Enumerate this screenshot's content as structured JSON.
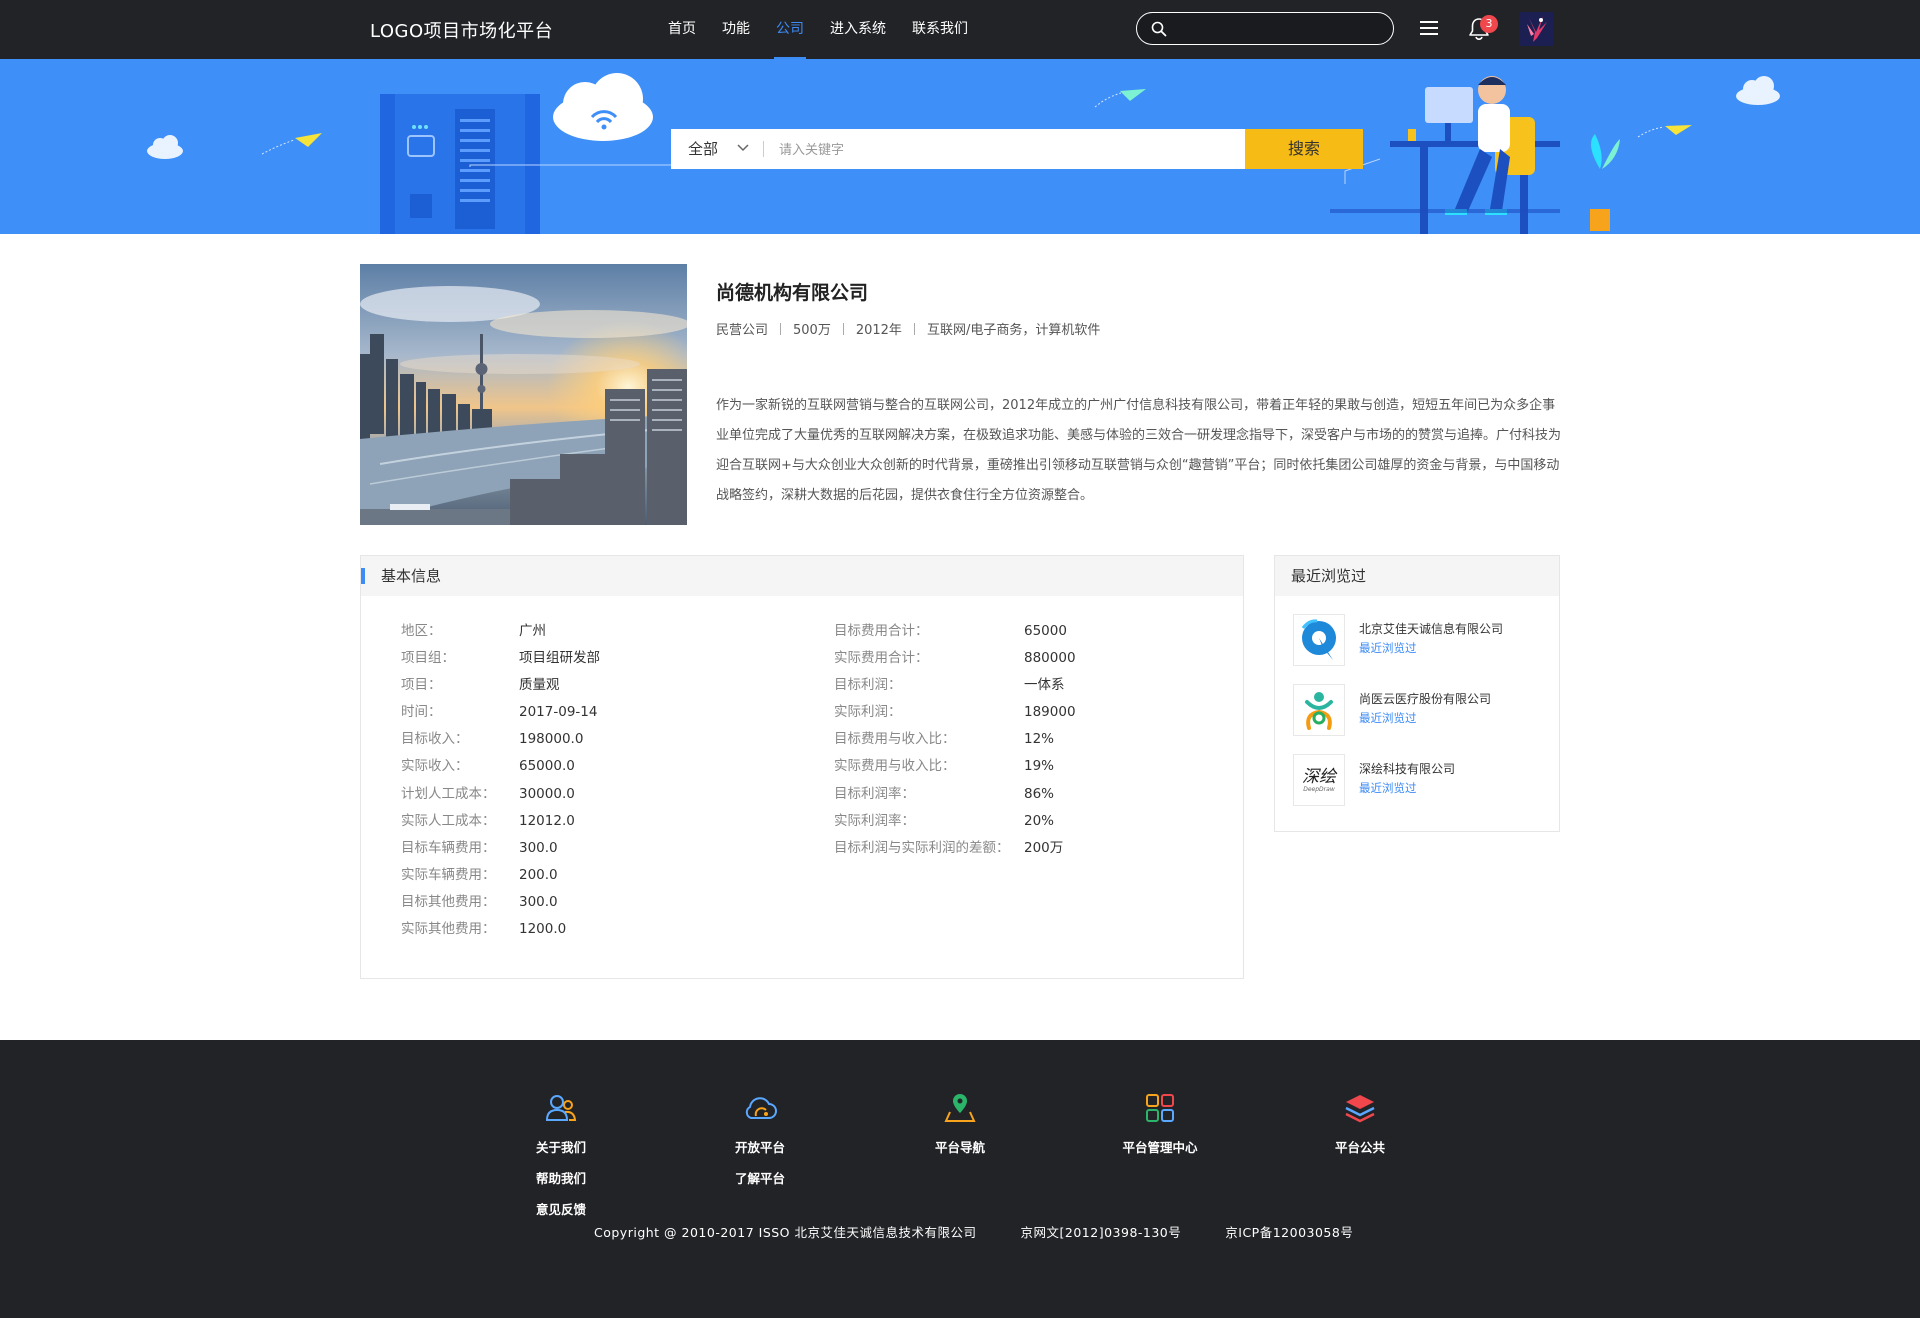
{
  "header": {
    "logo": "LOGO项目市场化平台",
    "nav": [
      "首页",
      "功能",
      "公司",
      "进入系统",
      "联系我们"
    ],
    "active_nav": "公司",
    "search_value": "",
    "notification_count": "3"
  },
  "banner": {
    "category": "全部",
    "search_placeholder": "请入关键字",
    "search_button": "搜索"
  },
  "company": {
    "name": "尚德机构有限公司",
    "meta": [
      "民营公司",
      "500万",
      "2012年",
      "互联网/电子商务，计算机软件"
    ],
    "description": "作为一家新锐的互联网营销与整合的互联网公司，2012年成立的广州广付信息科技有限公司，带着正年轻的果敢与创造，短短五年间已为众多企事业单位完成了大量优秀的互联网解决方案，在极致追求功能、美感与体验的三效合一研发理念指导下，深受客户与市场的的赞赏与追捧。广付科技为迎合互联网+与大众创业大众创新的时代背景，重磅推出引领移动互联营销与众创“趣营销”平台；同时依托集团公司雄厚的资金与背景，与中国移动战略签约，深耕大数据的后花园，提供衣食住行全方位资源整合。"
  },
  "basic_info": {
    "title": "基本信息",
    "left": [
      {
        "k": "地区：",
        "v": "广州"
      },
      {
        "k": "项目组：",
        "v": "项目组研发部"
      },
      {
        "k": "项目：",
        "v": "质量观"
      },
      {
        "k": "时间：",
        "v": "2017-09-14"
      },
      {
        "k": "目标收入：",
        "v": "198000.0"
      },
      {
        "k": "实际收入：",
        "v": "65000.0"
      },
      {
        "k": "计划人工成本：",
        "v": "30000.0"
      },
      {
        "k": "实际人工成本：",
        "v": "12012.0"
      },
      {
        "k": "目标车辆费用：",
        "v": "300.0"
      },
      {
        "k": "实际车辆费用：",
        "v": "200.0"
      },
      {
        "k": "目标其他费用：",
        "v": "300.0"
      },
      {
        "k": "实际其他费用：",
        "v": "1200.0"
      }
    ],
    "right": [
      {
        "k": "目标费用合计：",
        "v": "65000"
      },
      {
        "k": "实际费用合计：",
        "v": "880000"
      },
      {
        "k": "目标利润：",
        "v": "一体系"
      },
      {
        "k": "实际利润：",
        "v": "189000"
      },
      {
        "k": "目标费用与收入比：",
        "v": "12%"
      },
      {
        "k": "实际费用与收入比：",
        "v": "19%"
      },
      {
        "k": "目标利润率：",
        "v": "86%"
      },
      {
        "k": "实际利润率：",
        "v": "20%"
      },
      {
        "k": "目标利润与实际利润的差额：",
        "v": "200万"
      }
    ]
  },
  "recent": {
    "title": "最近浏览过",
    "items": [
      {
        "name": "北京艾佳天诚信息有限公司",
        "link": "最近浏览过"
      },
      {
        "name": "尚医云医疗股份有限公司",
        "link": "最近浏览过"
      },
      {
        "name": "深绘科技有限公司",
        "link": "最近浏览过"
      }
    ],
    "logo3_text": "深绘",
    "logo3_sub": "DeepDraw"
  },
  "footer": {
    "columns": [
      {
        "icon": "users-icon",
        "links": [
          "关于我们",
          "帮助我们",
          "意见反馈"
        ]
      },
      {
        "icon": "cloud-icon",
        "links": [
          "开放平台",
          "了解平台"
        ]
      },
      {
        "icon": "map-pin-icon",
        "links": [
          "平台导航"
        ]
      },
      {
        "icon": "grid-icon",
        "links": [
          "平台管理中心"
        ]
      },
      {
        "icon": "layers-icon",
        "links": [
          "平台公共"
        ]
      }
    ],
    "copyright": "Copyright @ 2010-2017 ISSO 北京艾佳天诚信息技术有限公司",
    "license1": "京网文[2012]0398-130号",
    "license2": "京ICP备12003058号"
  },
  "colors": {
    "topbar": "#222327",
    "banner": "#3e8ff7",
    "accent": "#3d8bf5",
    "search_button": "#f6bb14",
    "badge": "#f0474d"
  }
}
